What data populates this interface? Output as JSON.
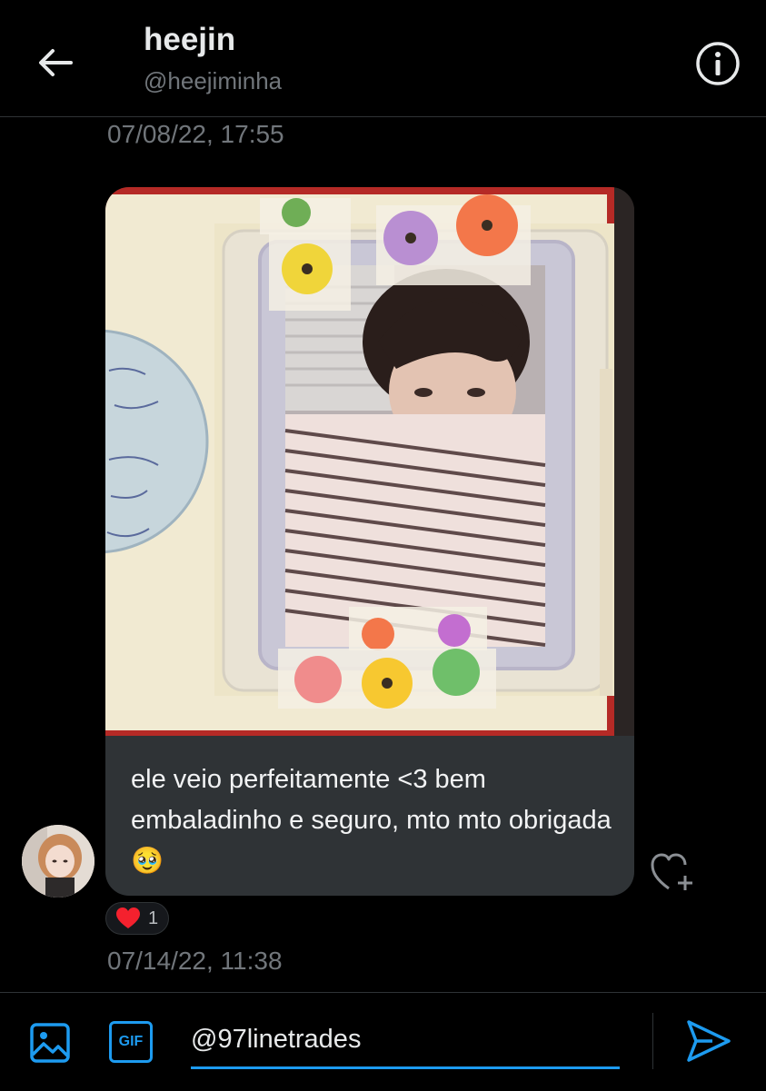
{
  "header": {
    "name": "heejin",
    "handle": "@heejiminha"
  },
  "messages": [
    {
      "timestamp": "07/08/22, 17:55"
    },
    {
      "text": "ele veio perfeitamente <3 bem embaladinho e seguro, mto mto obrigada 🥹",
      "reaction_emoji": "red-heart",
      "reaction_count": "1",
      "timestamp": "07/14/22, 11:38"
    }
  ],
  "composer": {
    "input_value": "@97linetrades",
    "gif_label": "GIF"
  },
  "colors": {
    "accent": "#1d9bf0",
    "background": "#000000",
    "bubble": "#2f3336",
    "muted_text": "#71767b",
    "heart": "#f91880"
  },
  "icons": [
    "back-arrow-icon",
    "info-icon",
    "heart-plus-icon",
    "image-icon",
    "gif-icon",
    "send-icon"
  ]
}
